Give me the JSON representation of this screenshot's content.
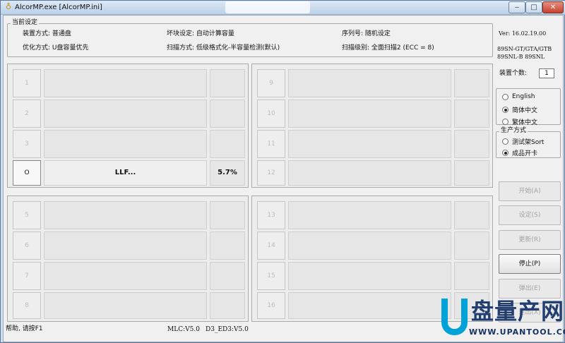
{
  "window": {
    "title": "AlcorMP.exe [AlcorMP.ini]",
    "title_icon": "lightbulb-icon",
    "controls": [
      "‒",
      "□",
      "✕"
    ]
  },
  "settings": {
    "legend": "当前设定",
    "mode": "装置方式: 普通盘",
    "bad_block": "坏块设定: 自动计算容量",
    "serial": "序列号: 随机设定",
    "optimize": "优化方式: U盘容量优先",
    "scan": "扫描方式: 低级格式化-半容量检测(默认)",
    "scan_level": "扫描级别: 全面扫描2 (ECC = 8)"
  },
  "version": {
    "ver": "Ver: 16.02.19.00",
    "model1": "89SN-GT/GTA/GTB",
    "model2": "89SNL-B 89SNL"
  },
  "device_count": {
    "label": "装置个数:",
    "value": "1"
  },
  "language": {
    "options": [
      "English",
      "简体中文",
      "繁体中文"
    ],
    "selected": "简体中文"
  },
  "production": {
    "legend": "生产方式",
    "options": [
      "测试架Sort",
      "成品开卡"
    ],
    "selected": "成品开卡"
  },
  "buttons": {
    "start": "开始(A)",
    "setup": "设定(S)",
    "update": "更新(R)",
    "stop": "停止(P)",
    "eject": "弹出(E)",
    "exit": "退出(X)"
  },
  "ports": [
    {
      "label": "1",
      "status": "",
      "percent": "",
      "active": false
    },
    {
      "label": "2",
      "status": "",
      "percent": "",
      "active": false
    },
    {
      "label": "3",
      "status": "",
      "percent": "",
      "active": false
    },
    {
      "label": "O",
      "status": "LLF...",
      "percent": "5.7%",
      "active": true
    },
    {
      "label": "5",
      "status": "",
      "percent": "",
      "active": false
    },
    {
      "label": "6",
      "status": "",
      "percent": "",
      "active": false
    },
    {
      "label": "7",
      "status": "",
      "percent": "",
      "active": false
    },
    {
      "label": "8",
      "status": "",
      "percent": "",
      "active": false
    },
    {
      "label": "9",
      "status": "",
      "percent": "",
      "active": false
    },
    {
      "label": "10",
      "status": "",
      "percent": "",
      "active": false
    },
    {
      "label": "11",
      "status": "",
      "percent": "",
      "active": false
    },
    {
      "label": "12",
      "status": "",
      "percent": "",
      "active": false
    },
    {
      "label": "13",
      "status": "",
      "percent": "",
      "active": false
    },
    {
      "label": "14",
      "status": "",
      "percent": "",
      "active": false
    },
    {
      "label": "15",
      "status": "",
      "percent": "",
      "active": false
    },
    {
      "label": "16",
      "status": "",
      "percent": "",
      "active": false
    }
  ],
  "statusbar": {
    "help": "帮助, 请按F1",
    "mlc": "MLC:V5.0",
    "ed3": "D3_ED3:V5.0"
  },
  "watermark": {
    "brand": "盘量产网",
    "url": "WWW.UPANTOOL.COM"
  }
}
